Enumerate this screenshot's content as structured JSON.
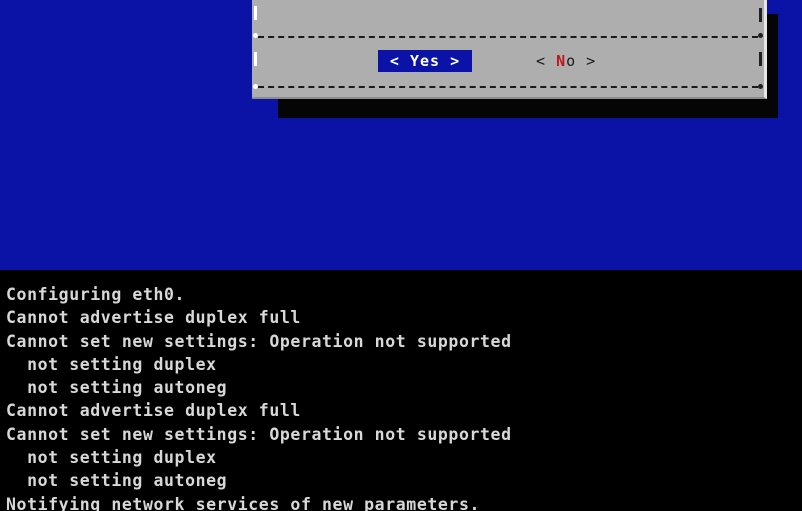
{
  "dialog": {
    "yes_button": {
      "open": "< ",
      "label": "Yes",
      "close": " >"
    },
    "no_button": {
      "open": "< ",
      "hotkey": "N",
      "rest": "o",
      "close": " >"
    }
  },
  "console": {
    "lines": [
      "Configuring eth0.",
      "Cannot advertise duplex full",
      "Cannot set new settings: Operation not supported",
      "  not setting duplex",
      "  not setting autoneg",
      "Cannot advertise duplex full",
      "Cannot set new settings: Operation not supported",
      "  not setting duplex",
      "  not setting autoneg",
      "Notifying network services of new parameters."
    ],
    "partial_line": ""
  },
  "colors": {
    "tui_background": "#0b13a6",
    "dialog_background": "#aeaeae",
    "console_text": "#d8d8d8",
    "hotkey": "#c0161a",
    "screen_background": "#000000"
  }
}
